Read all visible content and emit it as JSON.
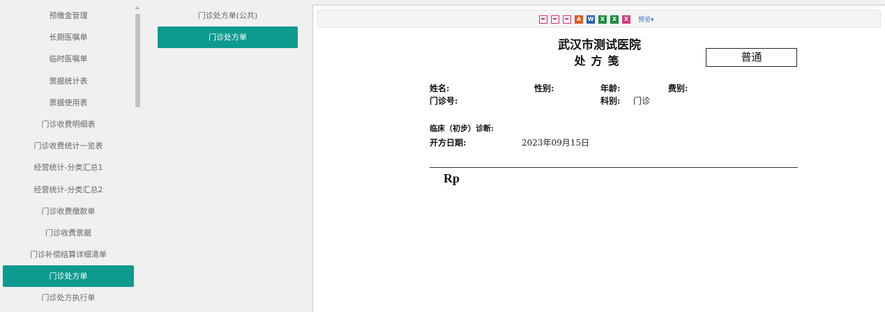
{
  "nav": {
    "items": [
      {
        "label": "预缴金管理"
      },
      {
        "label": "长期医嘱单"
      },
      {
        "label": "临时医嘱单"
      },
      {
        "label": "票据统计表"
      },
      {
        "label": "票据使用表"
      },
      {
        "label": "门诊收费明细表"
      },
      {
        "label": "门诊收费统计一览表"
      },
      {
        "label": "经营统计-分类汇总1"
      },
      {
        "label": "经营统计-分类汇总2"
      },
      {
        "label": "门诊收费缴款单"
      },
      {
        "label": "门诊收费票据"
      },
      {
        "label": "门诊补偿结算详细清单"
      },
      {
        "label": "门诊处方单"
      },
      {
        "label": "门诊处方执行单"
      }
    ],
    "active_index": 12
  },
  "sub_nav": {
    "items": [
      {
        "label": "门诊处方单(公共)"
      },
      {
        "label": "门诊处方单"
      }
    ],
    "active_index": 1
  },
  "toolbar": {
    "icons": [
      "print-design-icon",
      "print-icon",
      "print-preview-icon",
      "pdf-icon",
      "word-icon",
      "excel-icon",
      "excel-data-icon",
      "excel-alt-icon"
    ],
    "preview_label": "预览▾",
    "colors": {
      "accent": "#0f9a8f",
      "print": "#d9297b",
      "pdf": "#e05a1c",
      "word": "#2b5fb8",
      "excel": "#1e8a3d",
      "link": "#3a6fc8"
    }
  },
  "document": {
    "hospital": "武汉市测试医院",
    "title": "处方笺",
    "type": "普通",
    "fields": {
      "name_label": "姓名:",
      "gender_label": "性别:",
      "age_label": "年龄:",
      "fee_label": "费别:",
      "clinic_no_label": "门诊号:",
      "dept_label": "科别:",
      "dept_value": "门诊",
      "diagnosis_label": "临床（初步）诊断:",
      "date_label": "开方日期:",
      "date_value": "2023年09月15日"
    },
    "rp": "Rp"
  }
}
